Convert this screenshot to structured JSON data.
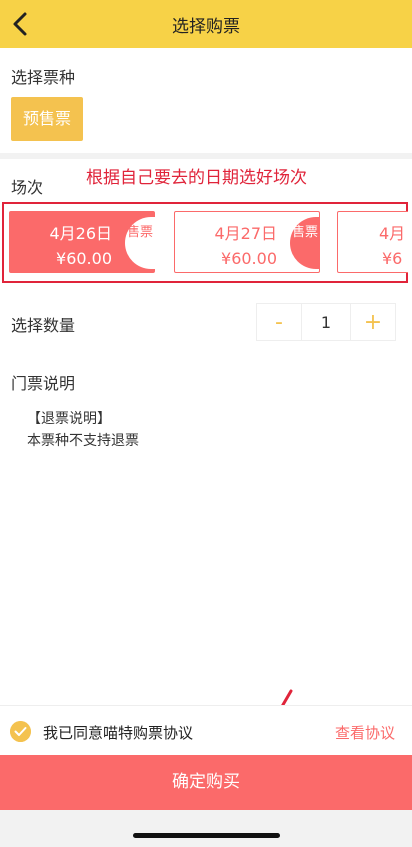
{
  "header": {
    "title": "选择购票",
    "back_icon": "chevron-left-icon"
  },
  "ticket_type": {
    "label": "选择票种",
    "option": "预售票"
  },
  "session": {
    "label": "场次",
    "annotation": "根据自己要去的日期选好场次",
    "cards": [
      {
        "date": "4月26日",
        "price": "¥60.00",
        "tag": "售票",
        "selected": true
      },
      {
        "date": "4月27日",
        "price": "¥60.00",
        "tag": "售票",
        "selected": false
      },
      {
        "date": "4月",
        "price": "¥6",
        "tag": "",
        "selected": false
      }
    ]
  },
  "quantity": {
    "label": "选择数量",
    "minus": "-",
    "value": "1",
    "plus": "+"
  },
  "notes": {
    "label": "门票说明",
    "refund_title": "【退票说明】",
    "refund_text": "本票种不支持退票"
  },
  "agreement": {
    "text": "我已同意喵特购票协议",
    "link": "查看协议",
    "checked": true
  },
  "confirm_button": "确定购买",
  "colors": {
    "header": "#f7d247",
    "accent": "#fb6a6a",
    "yellow": "#f4c24f",
    "annotation": "#e0243a"
  }
}
